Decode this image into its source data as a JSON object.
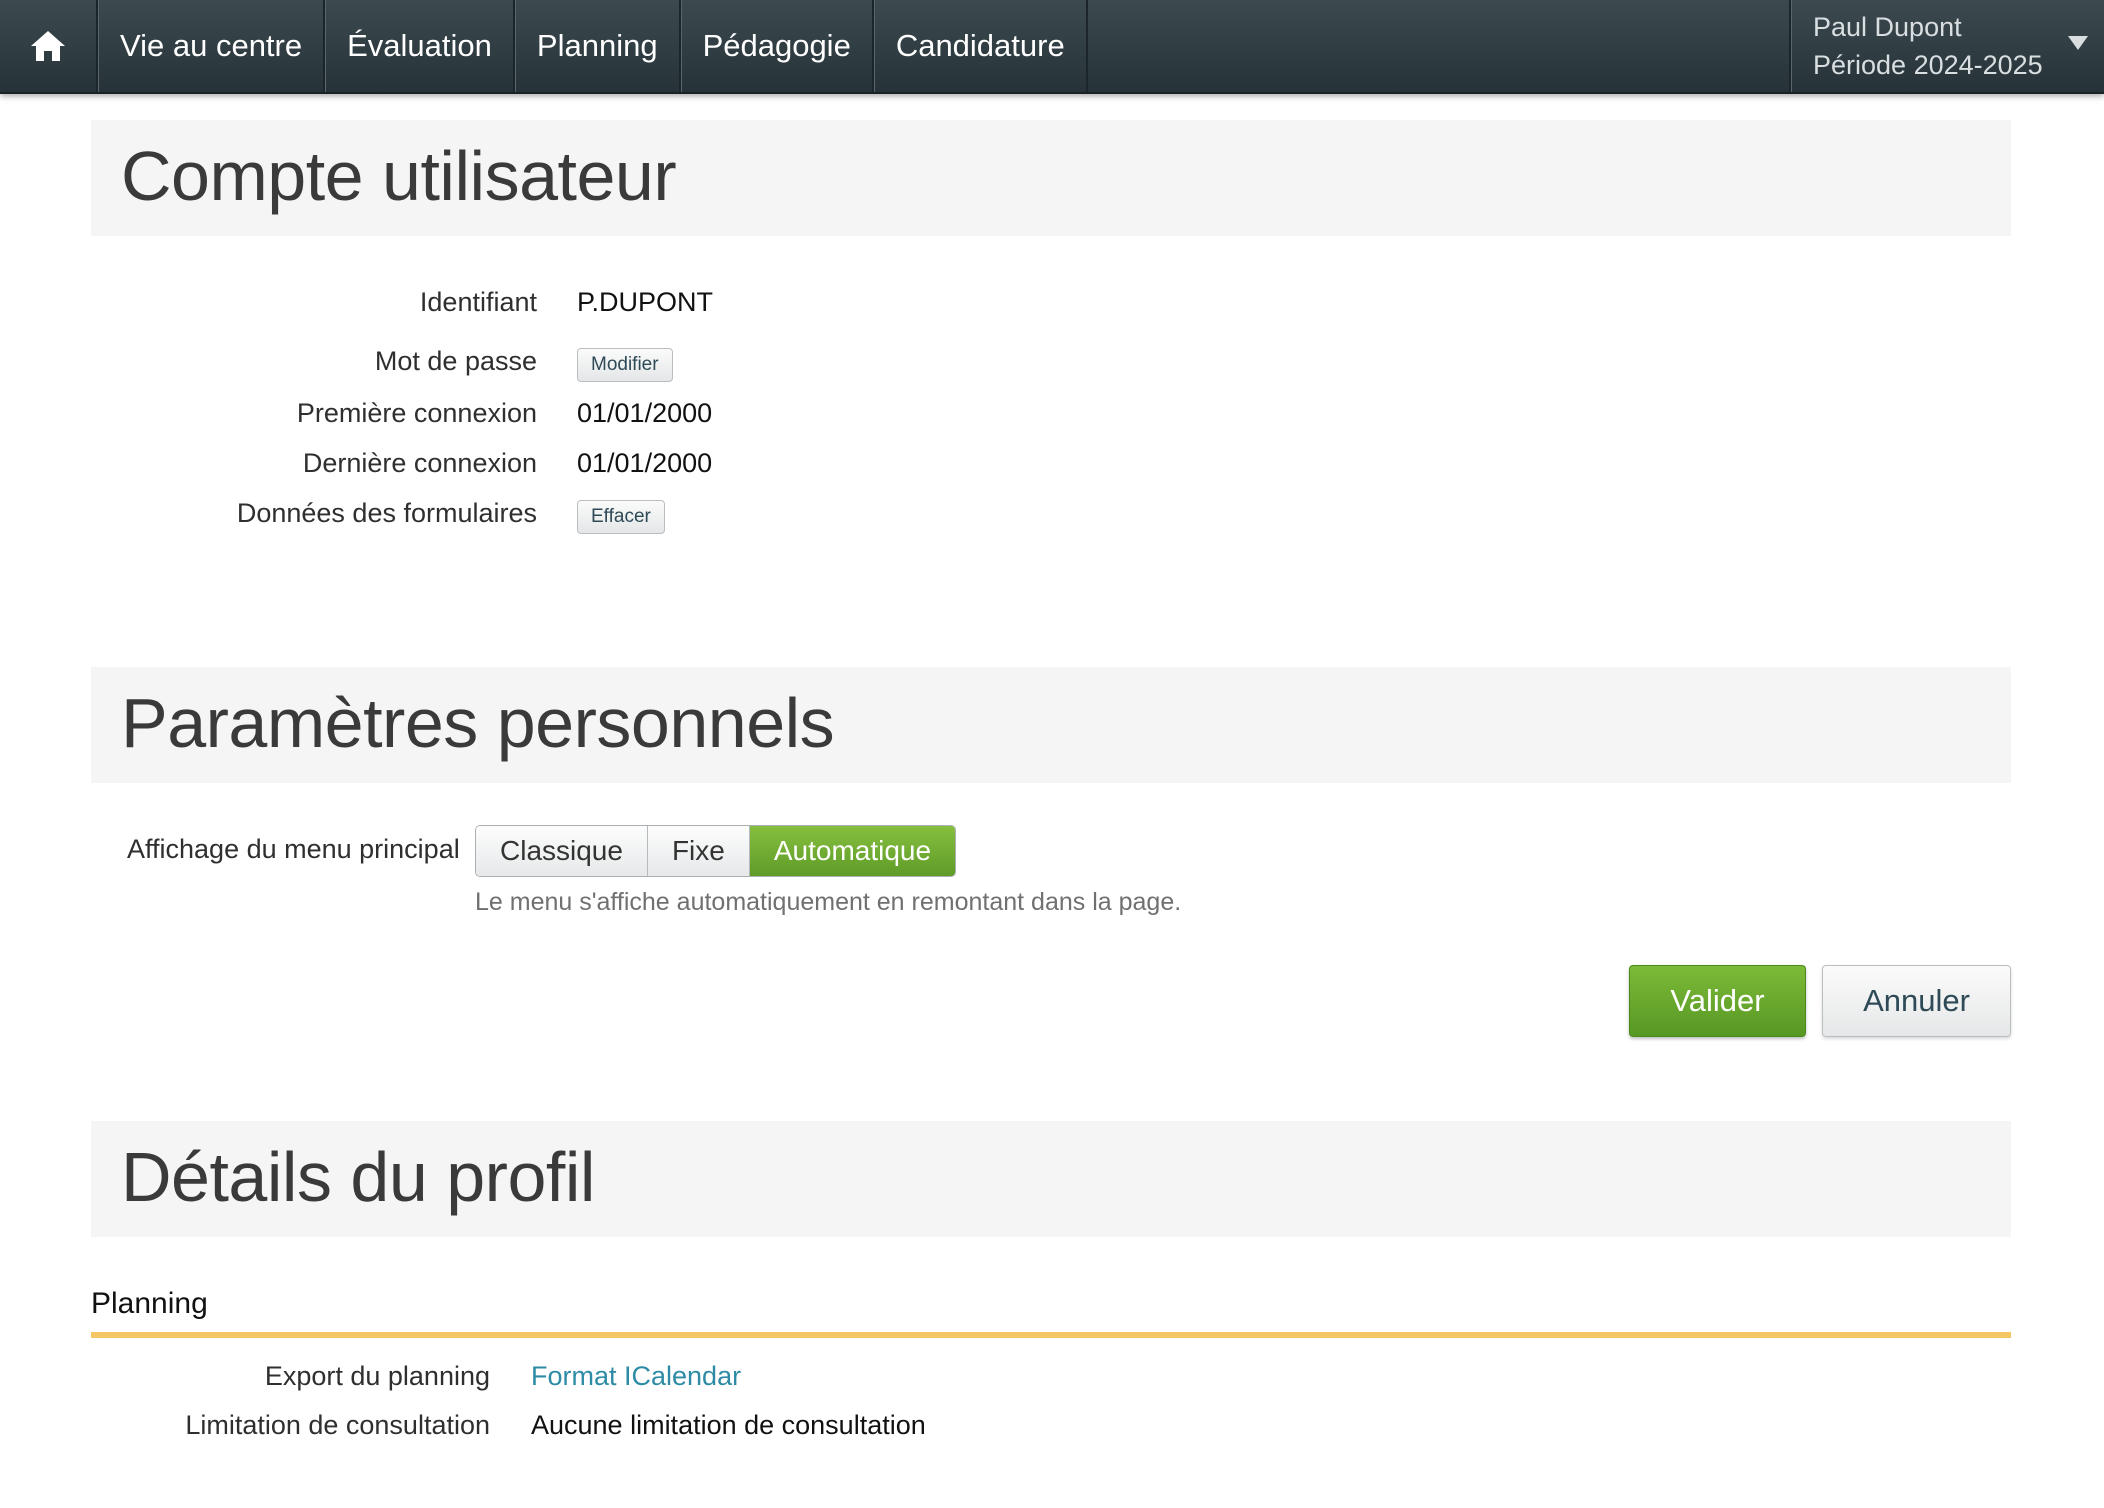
{
  "nav": {
    "home_icon": "home-icon",
    "items": [
      "Vie au centre",
      "Évaluation",
      "Planning",
      "Pédagogie",
      "Candidature"
    ],
    "user_name": "Paul Dupont",
    "period": "Période 2024-2025",
    "dropdown_icon": "caret-down-icon"
  },
  "compte": {
    "title": "Compte utilisateur",
    "identifiant_label": "Identifiant",
    "identifiant_value": "P.DUPONT",
    "mdp_label": "Mot de passe",
    "mdp_button": "Modifier",
    "premiere_label": "Première connexion",
    "premiere_value": "01/01/2000",
    "derniere_label": "Dernière connexion",
    "derniere_value": "01/01/2000",
    "donnees_label": "Données des formulaires",
    "donnees_button": "Effacer"
  },
  "parametres": {
    "title": "Paramètres personnels",
    "menu_label": "Affichage du menu principal",
    "options": [
      "Classique",
      "Fixe",
      "Automatique"
    ],
    "selected": "Automatique",
    "hint": "Le menu s'affiche automatiquement en remontant dans la page.",
    "valider": "Valider",
    "annuler": "Annuler",
    "accent_color": "#6aaa2e"
  },
  "profil": {
    "title": "Détails du profil",
    "subsection": "Planning",
    "export_label": "Export du planning",
    "export_link": "Format ICalendar",
    "limitation_label": "Limitation de consultation",
    "limitation_value": "Aucune limitation de consultation",
    "divider_color": "#f5c764"
  }
}
